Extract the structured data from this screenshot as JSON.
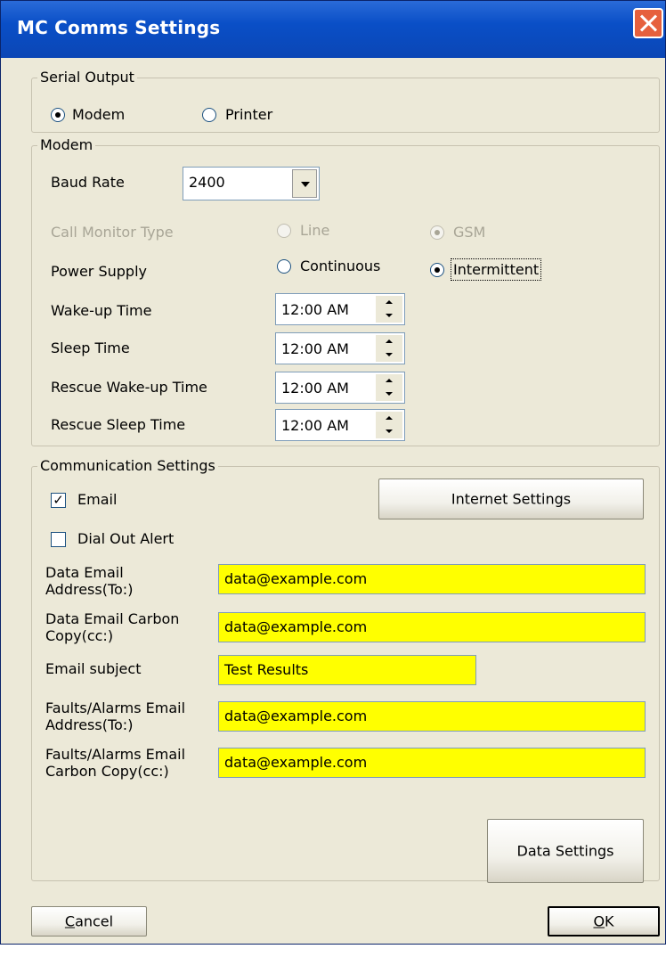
{
  "window": {
    "title": "MC Comms Settings",
    "close_icon": "close-icon"
  },
  "serial_output": {
    "legend": "Serial Output",
    "options": [
      {
        "label": "Modem",
        "checked": true
      },
      {
        "label": "Printer",
        "checked": false
      }
    ]
  },
  "modem": {
    "legend": "Modem",
    "baud_rate_label": "Baud Rate",
    "baud_rate_value": "2400",
    "call_monitor_label": "Call Monitor Type",
    "call_monitor_options": [
      {
        "label": "Line",
        "checked": false,
        "disabled": true
      },
      {
        "label": "GSM",
        "checked": true,
        "disabled": true
      }
    ],
    "power_supply_label": "Power Supply",
    "power_supply_options": [
      {
        "label": "Continuous",
        "checked": false
      },
      {
        "label": "Intermittent",
        "checked": true
      }
    ],
    "times": [
      {
        "label": "Wake-up Time",
        "value": "12:00 AM"
      },
      {
        "label": "Sleep Time",
        "value": "12:00 AM"
      },
      {
        "label": "Rescue Wake-up Time",
        "value": "12:00 AM"
      },
      {
        "label": "Rescue Sleep Time",
        "value": "12:00 AM"
      }
    ]
  },
  "communication": {
    "legend": "Communication Settings",
    "email_label": "Email",
    "email_checked": true,
    "dial_out_label": "Dial Out Alert",
    "dial_out_checked": false,
    "internet_settings_button": "Internet Settings",
    "fields": [
      {
        "label": "Data Email Address(To:)",
        "value": "data@example.com"
      },
      {
        "label": "Data Email Carbon Copy(cc:)",
        "value": "data@example.com"
      },
      {
        "label": "Email subject",
        "value": "Test Results"
      },
      {
        "label": "Faults/Alarms Email Address(To:)",
        "value": "data@example.com"
      },
      {
        "label": "Faults/Alarms Email Carbon Copy(cc:)",
        "value": "data@example.com"
      }
    ],
    "data_settings_button": "Data Settings"
  },
  "footer": {
    "cancel_label": "Cancel",
    "ok_label": "OK"
  },
  "colors": {
    "field_highlight": "#ffff00",
    "titlebar": "#0a4fc7",
    "dialog_bg": "#ece9d8"
  }
}
